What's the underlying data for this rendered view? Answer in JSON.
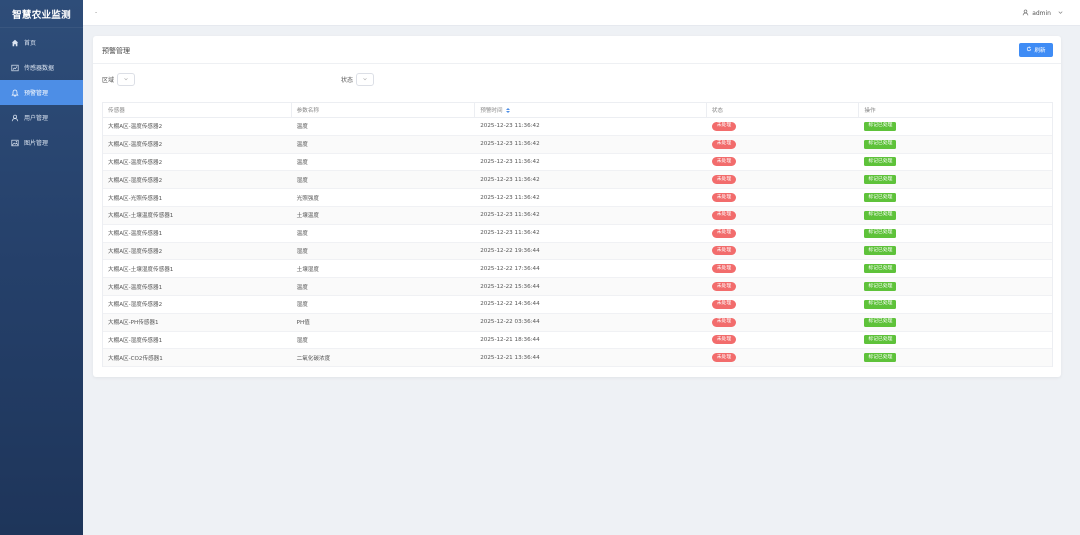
{
  "app": {
    "title": "智慧农业监测"
  },
  "sidebar": {
    "items": [
      {
        "label": "首页",
        "icon": "home-icon",
        "active": false
      },
      {
        "label": "传感器数据",
        "icon": "chart-icon",
        "active": false
      },
      {
        "label": "预警管理",
        "icon": "bell-icon",
        "active": true
      },
      {
        "label": "用户管理",
        "icon": "user-icon",
        "active": false
      },
      {
        "label": "图片管理",
        "icon": "image-icon",
        "active": false
      }
    ]
  },
  "header": {
    "breadcrumb": "-",
    "user": "admin"
  },
  "page": {
    "title": "预警管理",
    "refresh_label": "刷新",
    "filters": {
      "area_label": "区域",
      "status_label": "状态"
    }
  },
  "table": {
    "columns": [
      "传感器",
      "参数名称",
      "预警时间",
      "状态",
      "操作"
    ],
    "rows": [
      {
        "sensor": "大棚A区-温度传感器2",
        "param": "温度",
        "time": "2025-12-23 11:36:42",
        "status": "未处理",
        "action": "标记已处理"
      },
      {
        "sensor": "大棚A区-温度传感器2",
        "param": "温度",
        "time": "2025-12-23 11:36:42",
        "status": "未处理",
        "action": "标记已处理"
      },
      {
        "sensor": "大棚A区-温度传感器2",
        "param": "温度",
        "time": "2025-12-23 11:36:42",
        "status": "未处理",
        "action": "标记已处理"
      },
      {
        "sensor": "大棚A区-湿度传感器2",
        "param": "湿度",
        "time": "2025-12-23 11:36:42",
        "status": "未处理",
        "action": "标记已处理"
      },
      {
        "sensor": "大棚A区-光照传感器1",
        "param": "光照强度",
        "time": "2025-12-23 11:36:42",
        "status": "未处理",
        "action": "标记已处理"
      },
      {
        "sensor": "大棚A区-土壤温度传感器1",
        "param": "土壤温度",
        "time": "2025-12-23 11:36:42",
        "status": "未处理",
        "action": "标记已处理"
      },
      {
        "sensor": "大棚A区-温度传感器1",
        "param": "温度",
        "time": "2025-12-23 11:36:42",
        "status": "未处理",
        "action": "标记已处理"
      },
      {
        "sensor": "大棚A区-湿度传感器2",
        "param": "湿度",
        "time": "2025-12-22 19:36:44",
        "status": "未处理",
        "action": "标记已处理"
      },
      {
        "sensor": "大棚A区-土壤湿度传感器1",
        "param": "土壤湿度",
        "time": "2025-12-22 17:36:44",
        "status": "未处理",
        "action": "标记已处理"
      },
      {
        "sensor": "大棚A区-温度传感器1",
        "param": "温度",
        "time": "2025-12-22 15:36:44",
        "status": "未处理",
        "action": "标记已处理"
      },
      {
        "sensor": "大棚A区-湿度传感器2",
        "param": "湿度",
        "time": "2025-12-22 14:36:44",
        "status": "未处理",
        "action": "标记已处理"
      },
      {
        "sensor": "大棚A区-PH传感器1",
        "param": "PH值",
        "time": "2025-12-22 03:36:44",
        "status": "未处理",
        "action": "标记已处理"
      },
      {
        "sensor": "大棚A区-湿度传感器1",
        "param": "湿度",
        "time": "2025-12-21 18:36:44",
        "status": "未处理",
        "action": "标记已处理"
      },
      {
        "sensor": "大棚A区-CO2传感器1",
        "param": "二氧化碳浓度",
        "time": "2025-12-21 13:36:44",
        "status": "未处理",
        "action": "标记已处理"
      }
    ]
  },
  "colors": {
    "sidebar_bg": "#25406a",
    "accent": "#3f8cf5",
    "badge_red": "#f26c6c",
    "action_green": "#5ec23a"
  }
}
